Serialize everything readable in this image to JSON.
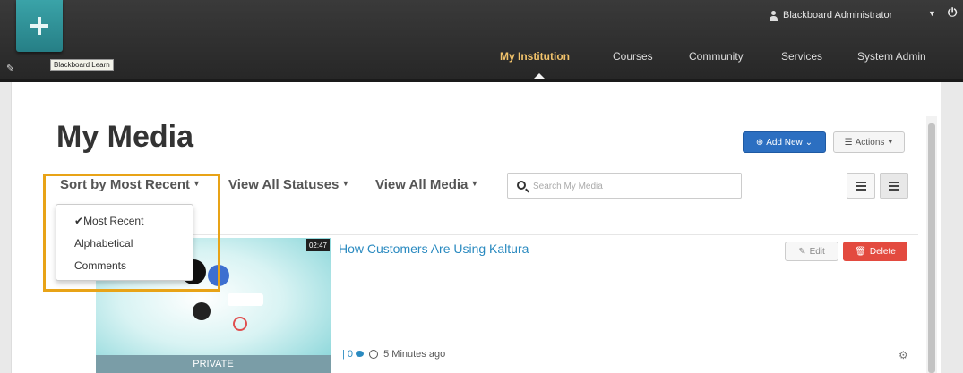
{
  "header": {
    "brand_tag": "Blackboard Learn",
    "user_name": "Blackboard Administrator",
    "nav": [
      "My Institution",
      "Courses",
      "Community",
      "Services",
      "System Admin"
    ]
  },
  "page": {
    "title": "My Media",
    "add_new_label": "Add New",
    "actions_label": "Actions"
  },
  "toolbar": {
    "sort_label": "Sort by Most Recent",
    "status_label": "View All Statuses",
    "media_label": "View All Media",
    "search_placeholder": "Search My Media"
  },
  "sort_menu": {
    "items": [
      "Most Recent",
      "Alphabetical",
      "Comments"
    ],
    "selected": "Most Recent"
  },
  "entry": {
    "title": "How Customers Are Using Kaltura",
    "duration": "02:47",
    "status": "PRIVATE",
    "comment_count": "0",
    "age": "5 Minutes ago",
    "edit_label": "Edit",
    "delete_label": "Delete"
  },
  "colors": {
    "accent": "#2c6fc1",
    "nav_active": "#f2c36b",
    "highlight": "#e8a317",
    "danger": "#e34a3f",
    "link": "#2a8ac0"
  },
  "icons": [
    "plus-icon",
    "pencil-icon",
    "user-icon",
    "chevron-down-icon",
    "power-icon",
    "search-icon",
    "list-view-icon",
    "detail-view-icon",
    "check-icon",
    "comment-icon",
    "clock-icon",
    "gear-icon",
    "trash-icon"
  ]
}
